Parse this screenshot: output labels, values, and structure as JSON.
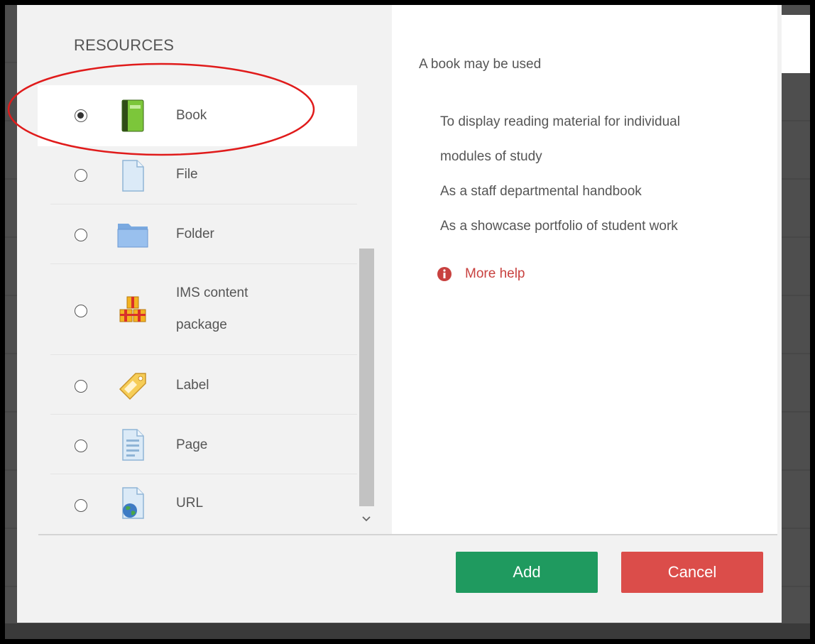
{
  "chooser": {
    "section_title": "RESOURCES",
    "items": [
      {
        "label": "Book",
        "icon": "book-icon",
        "selected": true
      },
      {
        "label": "File",
        "icon": "file-icon",
        "selected": false
      },
      {
        "label": "Folder",
        "icon": "folder-icon",
        "selected": false
      },
      {
        "label_line1": "IMS content",
        "label_line2": "package",
        "icon": "package-icon",
        "selected": false
      },
      {
        "label": "Label",
        "icon": "tag-icon",
        "selected": false
      },
      {
        "label": "Page",
        "icon": "page-icon",
        "selected": false
      },
      {
        "label": "URL",
        "icon": "url-globe-icon",
        "selected": false
      }
    ]
  },
  "help": {
    "intro": "A book may be used",
    "points": [
      "To display reading material for individual",
      "modules of study",
      "As a staff departmental handbook",
      "As a showcase portfolio of student work"
    ],
    "more_help": "More help"
  },
  "buttons": {
    "add": "Add",
    "cancel": "Cancel"
  },
  "colors": {
    "add": "#1f9a5f",
    "cancel": "#db4d4a",
    "more_help": "#c8413f",
    "annotation": "#e01b1b"
  }
}
